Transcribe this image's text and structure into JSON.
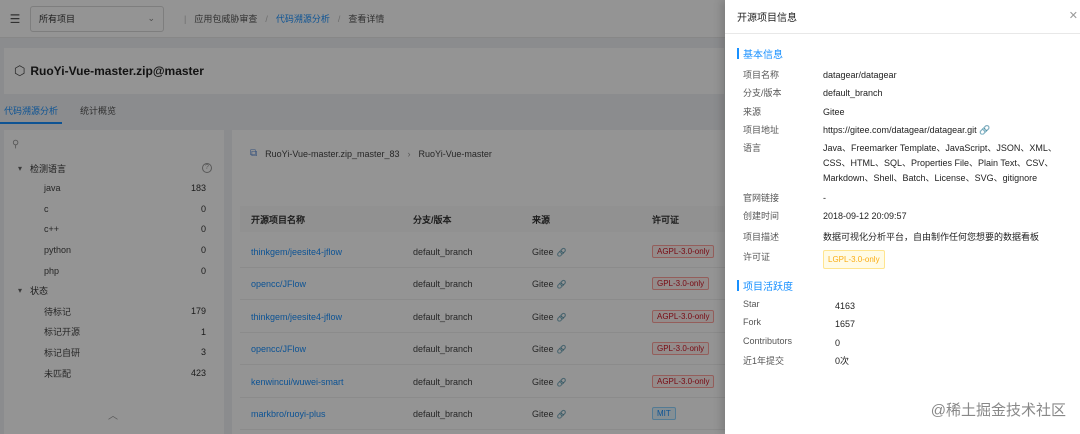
{
  "topbar": {
    "project_select": "所有项目",
    "breadcrumb": [
      "应用包威胁审查",
      "代码溯源分析",
      "查看详情"
    ]
  },
  "header": {
    "title": "RuoYi-Vue-master.zip@master"
  },
  "tabs": [
    "代码溯源分析",
    "统计概览"
  ],
  "filter": {
    "groups": [
      {
        "title": "检测语言",
        "items": [
          {
            "name": "java",
            "count": "183"
          },
          {
            "name": "c",
            "count": "0"
          },
          {
            "name": "c++",
            "count": "0"
          },
          {
            "name": "python",
            "count": "0"
          },
          {
            "name": "php",
            "count": "0"
          }
        ]
      },
      {
        "title": "状态",
        "items": [
          {
            "name": "待标记",
            "count": "179"
          },
          {
            "name": "标记开源",
            "count": "1"
          },
          {
            "name": "标记自研",
            "count": "3"
          },
          {
            "name": "未匹配",
            "count": "423"
          }
        ]
      }
    ]
  },
  "main": {
    "path": [
      "RuoYi-Vue-master.zip_master_83",
      "RuoYi-Vue-master"
    ],
    "columns": [
      "开源项目名称",
      "分支/版本",
      "来源",
      "许可证"
    ],
    "rows": [
      {
        "name": "thinkgem/jeesite4-jflow",
        "branch": "default_branch",
        "source": "Gitee",
        "license": "AGPL-3.0-only"
      },
      {
        "name": "opencc/JFlow",
        "branch": "default_branch",
        "source": "Gitee",
        "license": "GPL-3.0-only"
      },
      {
        "name": "thinkgem/jeesite4-jflow",
        "branch": "default_branch",
        "source": "Gitee",
        "license": "AGPL-3.0-only"
      },
      {
        "name": "opencc/JFlow",
        "branch": "default_branch",
        "source": "Gitee",
        "license": "GPL-3.0-only"
      },
      {
        "name": "kenwincui/wuwei-smart",
        "branch": "default_branch",
        "source": "Gitee",
        "license": "AGPL-3.0-only"
      },
      {
        "name": "markbro/ruoyi-plus",
        "branch": "default_branch",
        "source": "Gitee",
        "license": "MIT"
      }
    ]
  },
  "drawer": {
    "title": "开源项目信息",
    "basic_title": "基本信息",
    "basic": [
      {
        "k": "项目名称",
        "v": "datagear/datagear"
      },
      {
        "k": "分支/版本",
        "v": "default_branch"
      },
      {
        "k": "来源",
        "v": "Gitee"
      },
      {
        "k": "项目地址",
        "v": "https://gitee.com/datagear/datagear.git"
      },
      {
        "k": "语言",
        "v": "Java、Freemarker Template、JavaScript、JSON、XML、CSS、HTML、SQL、Properties File、Plain Text、CSV、Markdown、Shell、Batch、License、SVG、gitignore"
      },
      {
        "k": "官网链接",
        "v": "-"
      },
      {
        "k": "创建时间",
        "v": "2018-09-12 20:09:57"
      },
      {
        "k": "项目描述",
        "v": "数据可视化分析平台，自由制作任何您想要的数据看板"
      },
      {
        "k": "许可证",
        "v": "LGPL-3.0-only"
      }
    ],
    "activity_title": "项目活跃度",
    "activity": [
      {
        "k": "Star",
        "v": "4163"
      },
      {
        "k": "Fork",
        "v": "1657"
      },
      {
        "k": "Contributors",
        "v": "0"
      },
      {
        "k": "近1年提交",
        "v": "0次"
      }
    ]
  },
  "watermark": "@稀土掘金技术社区"
}
